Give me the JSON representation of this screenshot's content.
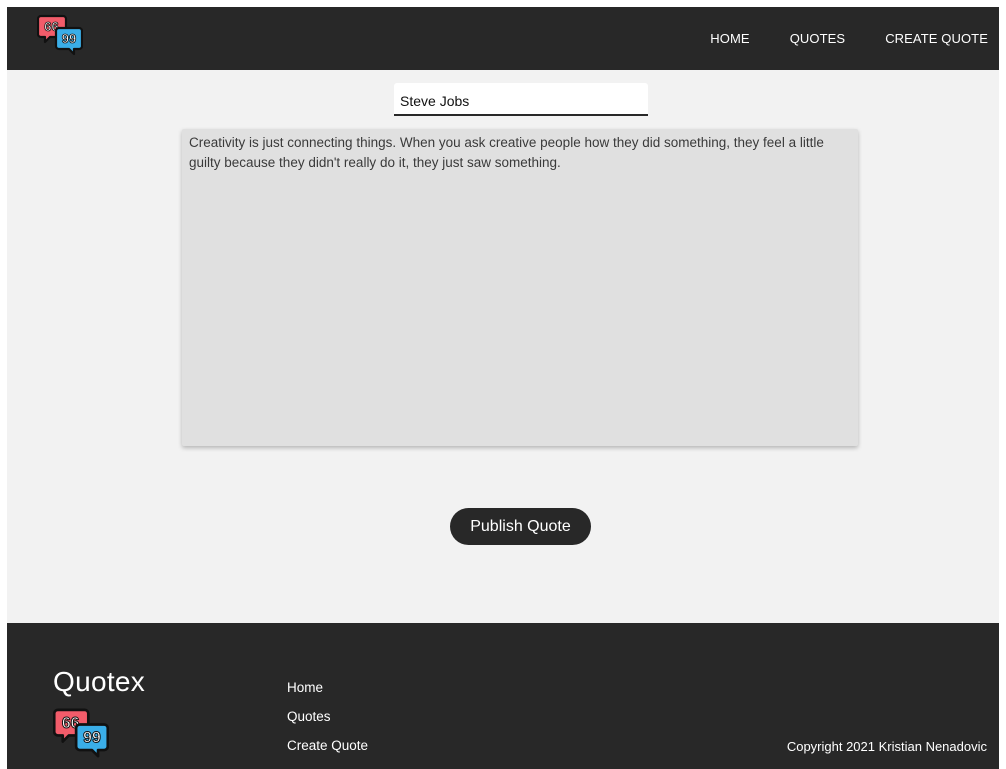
{
  "header": {
    "logo_icon": "quote-bubbles-icon",
    "nav": [
      {
        "label": "HOME"
      },
      {
        "label": "QUOTES"
      },
      {
        "label": "CREATE QUOTE"
      }
    ]
  },
  "form": {
    "author_value": "Steve Jobs",
    "quote_value": "Creativity is just connecting things. When you ask creative people how they did something, they feel a little guilty because they didn't really do it, they just saw something.",
    "publish_label": "Publish Quote"
  },
  "footer": {
    "brand": "Quotex",
    "logo_icon": "quote-bubbles-icon",
    "links": [
      {
        "label": "Home"
      },
      {
        "label": "Quotes"
      },
      {
        "label": "Create Quote"
      }
    ],
    "copyright": "Copyright 2021 Kristian Nenadovic"
  },
  "colors": {
    "dark": "#282828",
    "page_bg": "#f2f2f2",
    "textarea_bg": "#e0e0e0",
    "logo_red": "#f25c6a",
    "logo_blue": "#3aaee8"
  }
}
